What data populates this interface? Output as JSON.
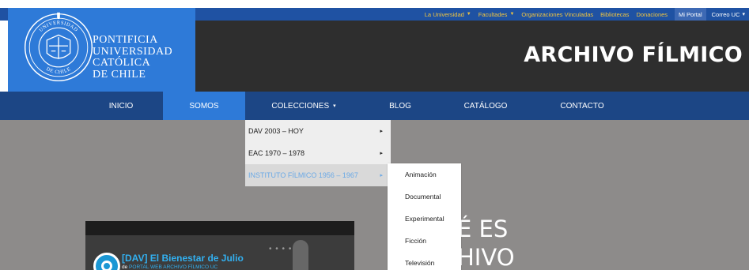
{
  "topbar": {
    "links": [
      {
        "label": "La Universidad",
        "has_caret": true
      },
      {
        "label": "Facultades",
        "has_caret": true
      },
      {
        "label": "Organizaciones Vinculadas",
        "has_caret": false
      },
      {
        "label": "Bibliotecas",
        "has_caret": false
      },
      {
        "label": "Donaciones",
        "has_caret": false
      }
    ],
    "mi_portal": "Mi Portal",
    "correo": "Correo UC",
    "correo_caret": "▾"
  },
  "header": {
    "university_lines": [
      "PONTIFICIA",
      "UNIVERSIDAD",
      "CATÓLICA",
      "DE CHILE"
    ],
    "seal_text_top": "UNIVERSIDAD",
    "seal_text_right": "CATOLICA",
    "seal_text_bottom": "DE CHILE",
    "seal_text_left": "PONTIFICIA",
    "site_title": "ARCHIVO FÍLMICO"
  },
  "nav": {
    "items": [
      {
        "label": "INICIO"
      },
      {
        "label": "SOMOS"
      },
      {
        "label": "COLECCIONES",
        "caret": "▾"
      },
      {
        "label": "BLOG"
      },
      {
        "label": "CATÁLOGO"
      },
      {
        "label": "CONTACTO"
      }
    ]
  },
  "dropdown": {
    "items": [
      {
        "label": "DAV 2003 – HOY",
        "arrow": "▸"
      },
      {
        "label": "EAC 1970 – 1978",
        "arrow": "▸"
      },
      {
        "label": "INSTITUTO FÍLMICO 1956 – 1967",
        "arrow": "▸"
      }
    ]
  },
  "submenu": {
    "items": [
      "Animación",
      "Documental",
      "Experimental",
      "Ficción",
      "Televisión"
    ]
  },
  "video": {
    "title": "[DAV] El Bienestar de Julio",
    "by_prefix": "de",
    "by_channel": "PORTAL WEB ARCHIVO FÍLMICO UC",
    "dots": "• • • •"
  },
  "hero": {
    "line1": "É ES",
    "line2": "HIVO"
  },
  "colors": {
    "topbar": "#1f52a3",
    "logo_blue": "#2e7ad8",
    "dark_header": "#2e2e2e",
    "nav": "#1c4685",
    "gold_links": "#f3c63f",
    "hover_text": "#6aa9e6",
    "page_bg": "#8d8b8a"
  }
}
